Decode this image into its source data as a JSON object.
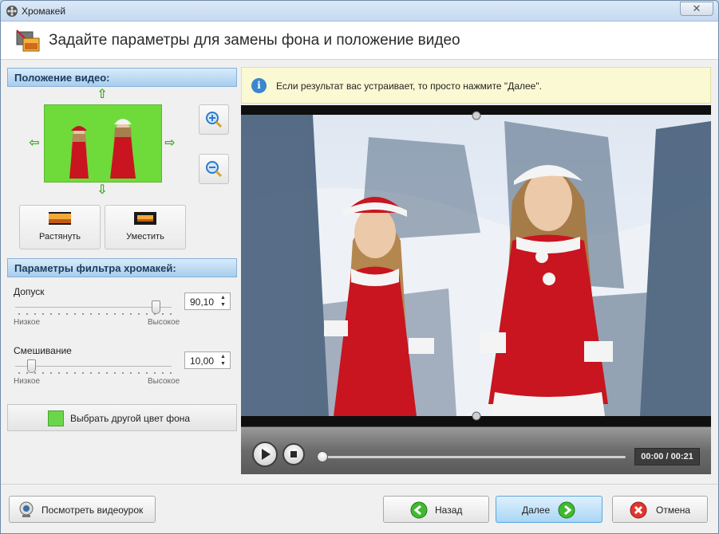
{
  "window": {
    "title": "Хромакей"
  },
  "header": {
    "title": "Задайте параметры для замены фона и положение видео"
  },
  "position_panel": {
    "title": "Положение видео:",
    "stretch_label": "Растянуть",
    "fit_label": "Уместить"
  },
  "filter_panel": {
    "title": "Параметры фильтра хромакей:",
    "tolerance": {
      "label": "Допуск",
      "value": "90,10",
      "low": "Низкое",
      "high": "Высокое",
      "level": 0.9
    },
    "blending": {
      "label": "Смешивание",
      "value": "10,00",
      "low": "Низкое",
      "high": "Высокое",
      "level": 0.1
    },
    "color_button_label": "Выбрать другой цвет фона",
    "key_color": "#6cd64a"
  },
  "info": {
    "text": "Если результат вас устраивает, то просто нажмите \"Далее\"."
  },
  "player": {
    "time": "00:00 / 00:21",
    "progress": 0
  },
  "footer": {
    "tutorial_label": "Посмотреть видеоурок",
    "back_label": "Назад",
    "next_label": "Далее",
    "cancel_label": "Отмена"
  }
}
